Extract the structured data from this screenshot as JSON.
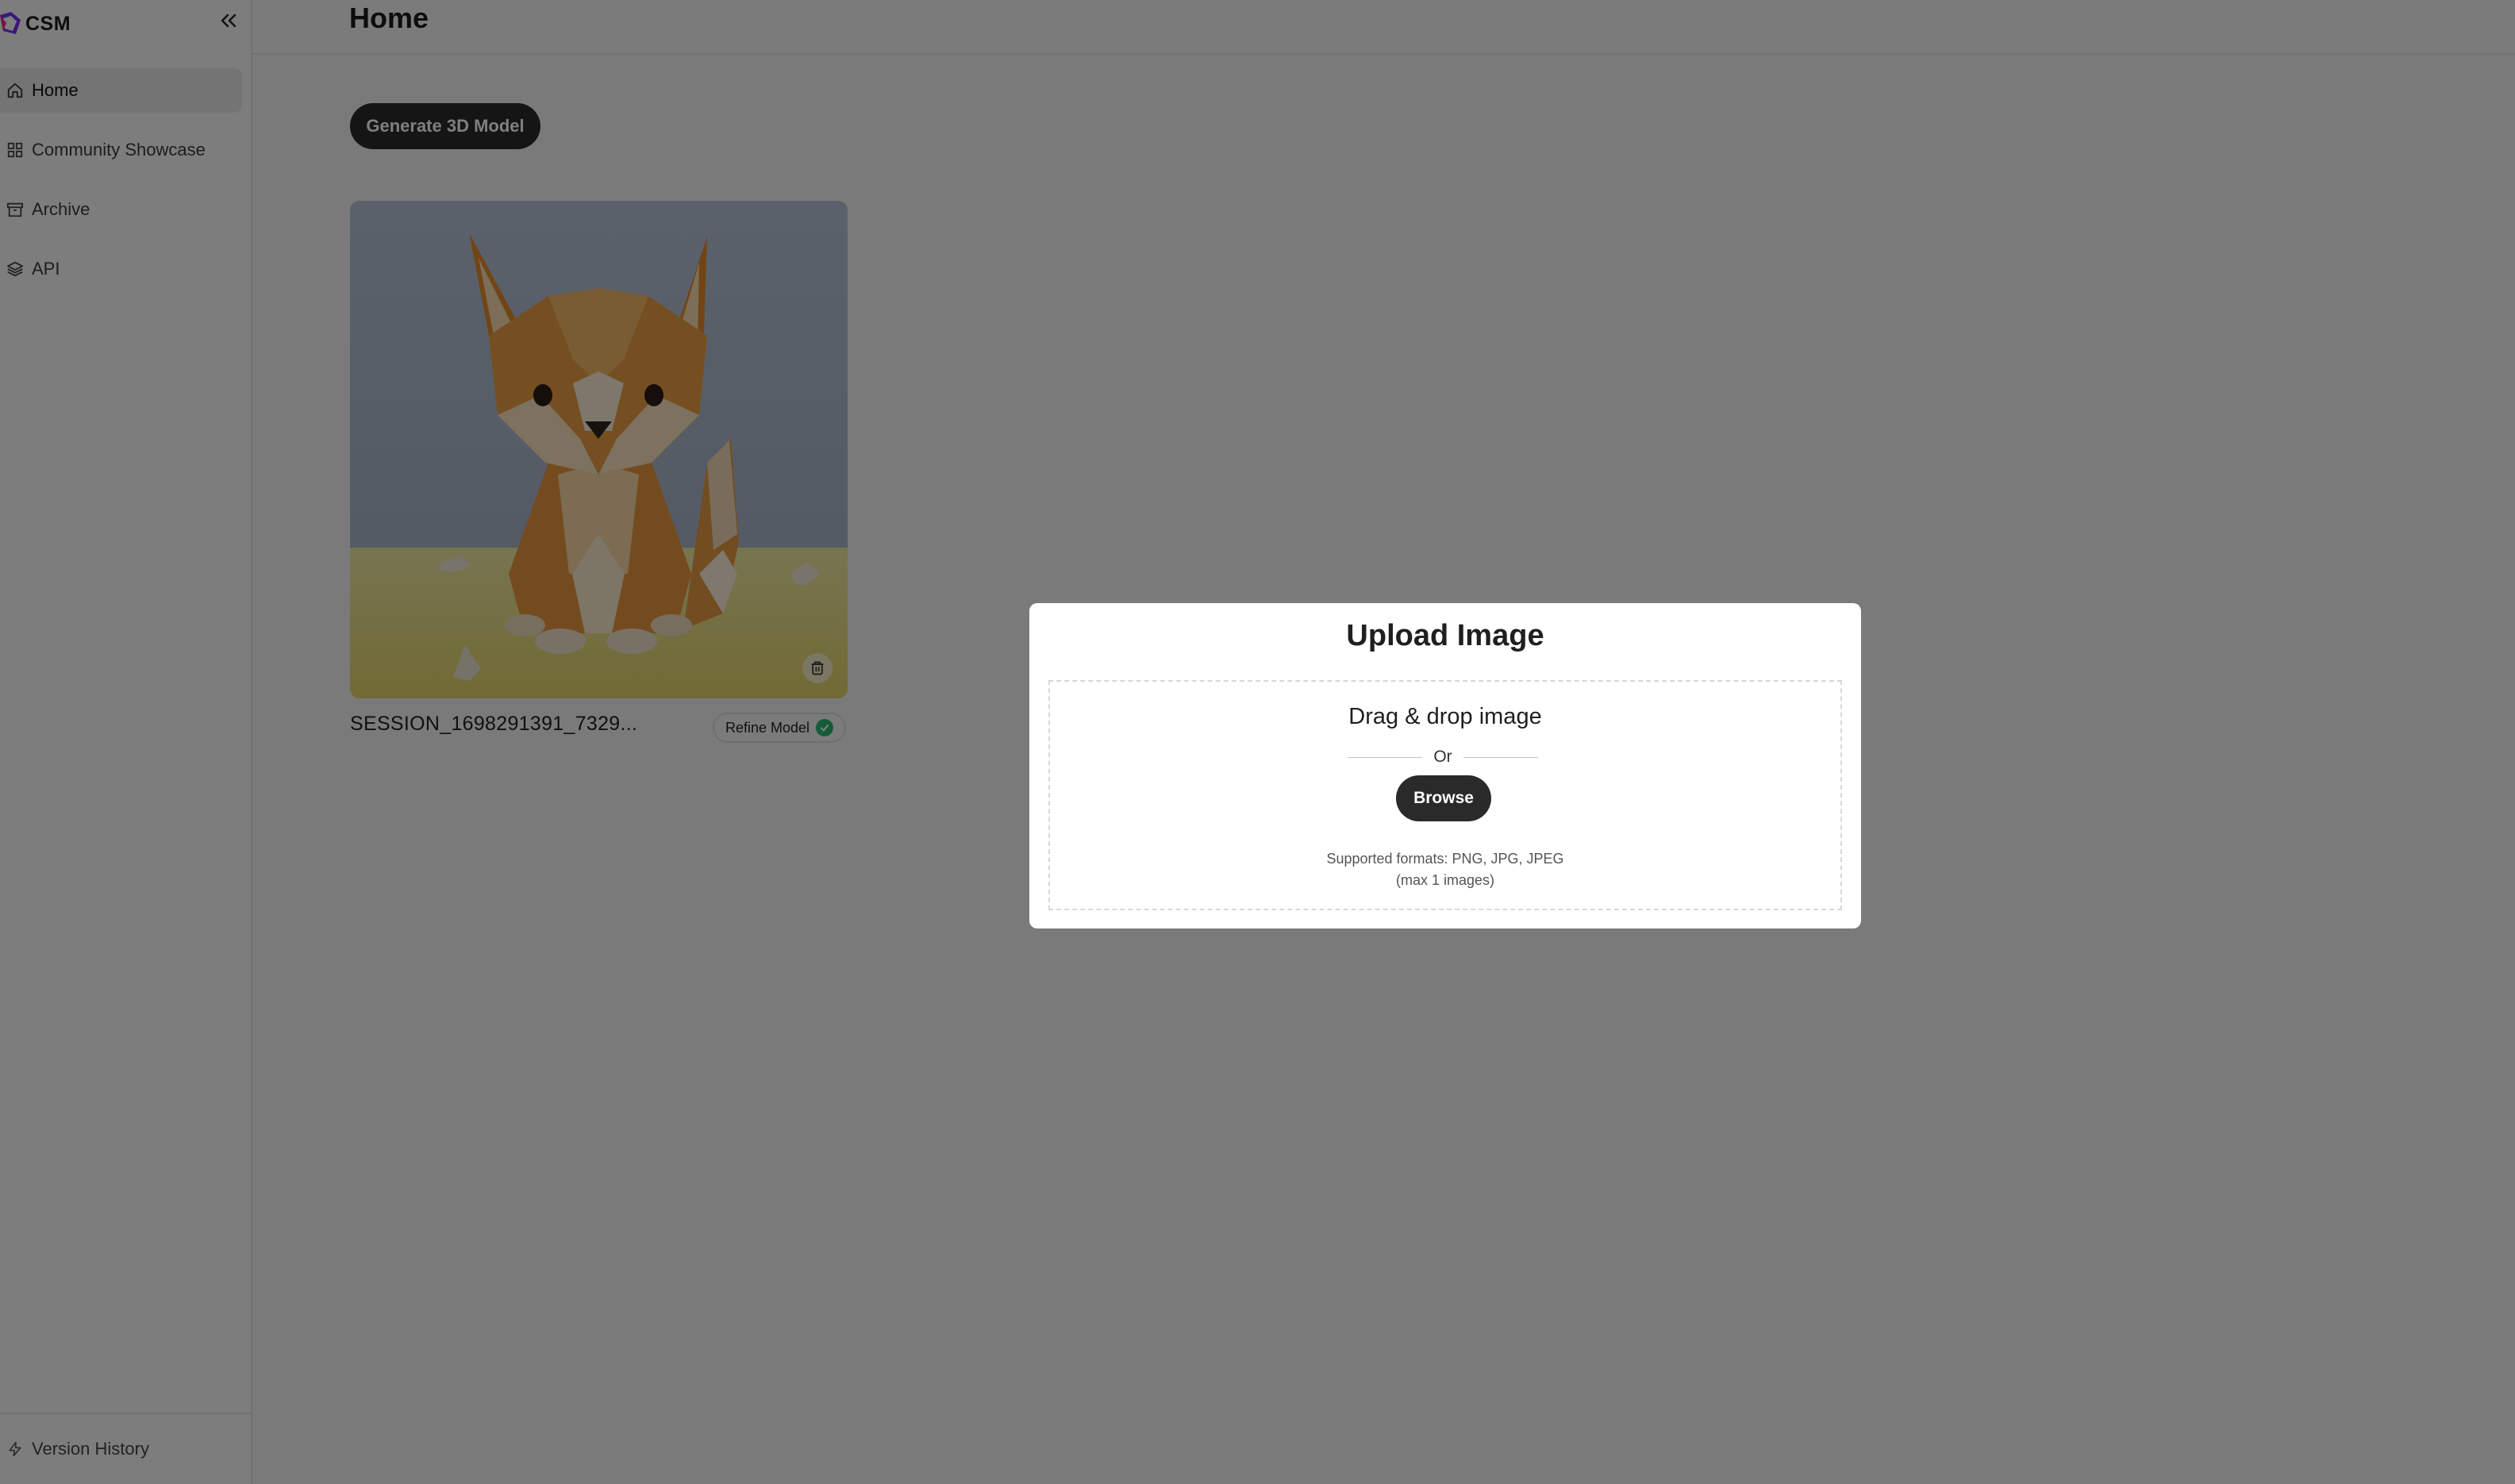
{
  "brand": {
    "name": "CSM"
  },
  "sidebar": {
    "items": [
      {
        "label": "Home",
        "icon": "home-icon",
        "active": true
      },
      {
        "label": "Community Showcase",
        "icon": "grid-icon",
        "active": false
      },
      {
        "label": "Archive",
        "icon": "archive-icon",
        "active": false
      },
      {
        "label": "API",
        "icon": "layers-icon",
        "active": false
      }
    ],
    "footer": {
      "label": "Version History",
      "icon": "bolt-icon"
    }
  },
  "header": {
    "title": "Home"
  },
  "main": {
    "generate_button": "Generate 3D Model",
    "session": {
      "name": "SESSION_1698291391_7329...",
      "refine_label": "Refine Model",
      "refine_status": "complete",
      "image": "low-poly-fox-image"
    }
  },
  "modal": {
    "title": "Upload Image",
    "drop_title": "Drag & drop image",
    "or_text": "Or",
    "browse_label": "Browse",
    "formats_text": "Supported formats: PNG, JPG, JPEG",
    "max_text": "(max 1 images)"
  },
  "colors": {
    "accent_dark": "#2a2a2a",
    "status_green": "#2bb673",
    "overlay": "rgba(0,0,0,0.5)"
  }
}
